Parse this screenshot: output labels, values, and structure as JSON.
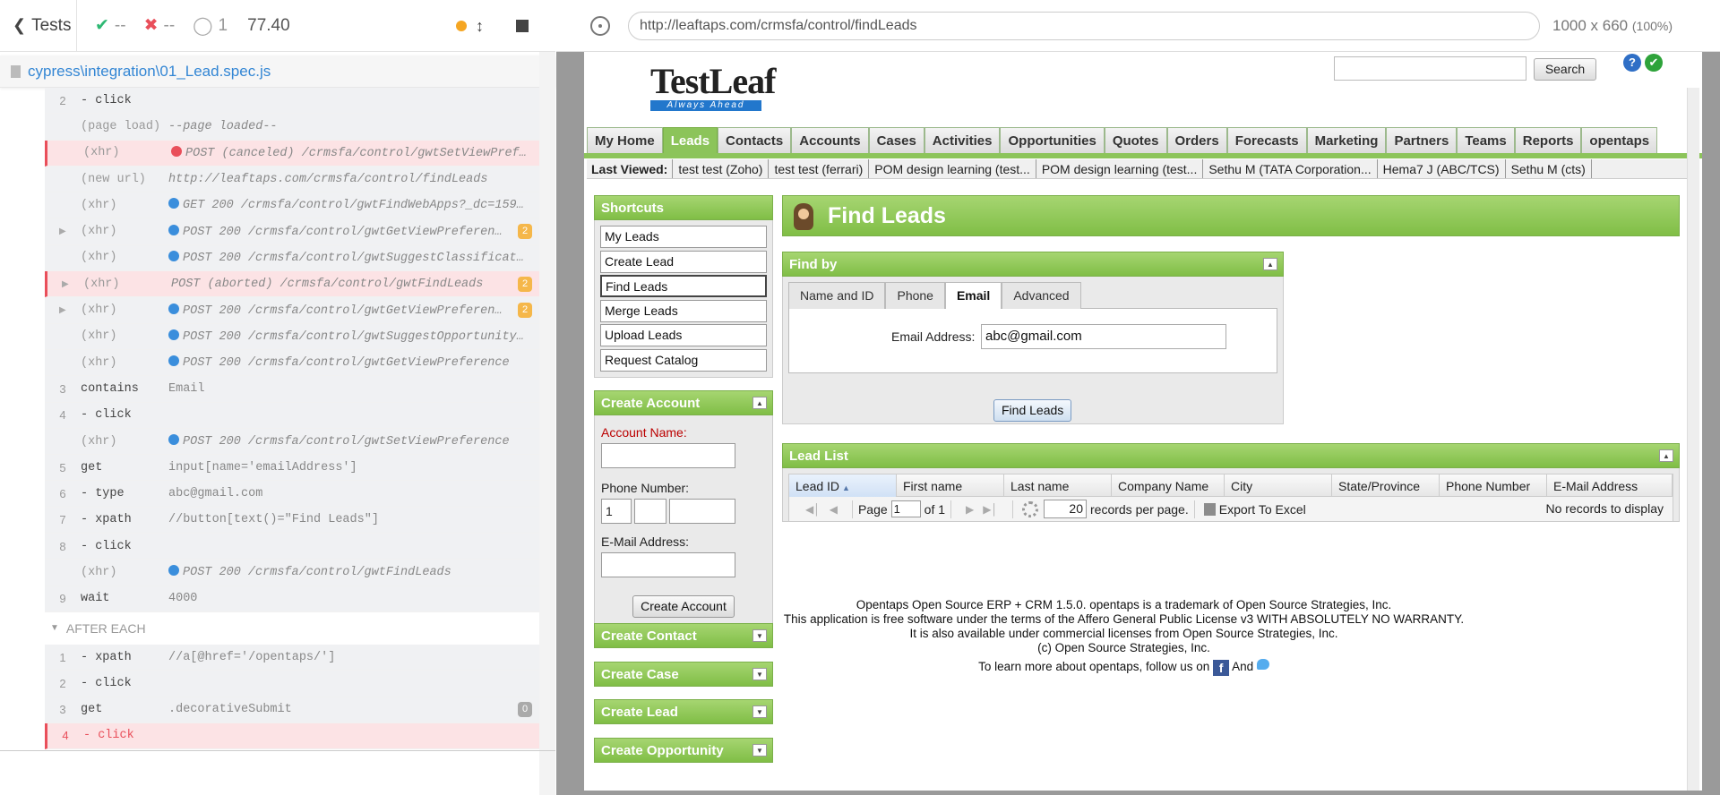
{
  "runner": {
    "tests_label": "Tests",
    "passed": "--",
    "failed": "--",
    "pending": "1",
    "duration": "77.40",
    "spec_path": "cypress\\integration\\01_Lead.spec.js",
    "commands": [
      {
        "num": "2",
        "name": "- click",
        "msg": "",
        "style": "",
        "dot": "",
        "badge": "",
        "arrow": false
      },
      {
        "num": "",
        "name": "(page load)",
        "msg": "--page loaded--",
        "style": "",
        "dot": "",
        "badge": "",
        "arrow": false
      },
      {
        "num": "",
        "name": "(xhr)",
        "msg": "POST (canceled) /crmsfa/control/gwtSetViewPref…",
        "style": "red",
        "dot": "red",
        "badge": "",
        "arrow": false
      },
      {
        "num": "",
        "name": "(new url)",
        "msg": "http://leaftaps.com/crmsfa/control/findLeads",
        "style": "",
        "dot": "",
        "badge": "",
        "arrow": false
      },
      {
        "num": "",
        "name": "(xhr)",
        "msg": "GET 200 /crmsfa/control/gwtFindWebApps?_dc=159…",
        "style": "",
        "dot": "blue",
        "badge": "",
        "arrow": false
      },
      {
        "num": "",
        "name": "(xhr)",
        "msg": "POST 200 /crmsfa/control/gwtGetViewPreferen…",
        "style": "",
        "dot": "blue",
        "badge": "2",
        "arrow": true
      },
      {
        "num": "",
        "name": "(xhr)",
        "msg": "POST 200 /crmsfa/control/gwtSuggestClassificat…",
        "style": "",
        "dot": "blue",
        "badge": "",
        "arrow": false
      },
      {
        "num": "",
        "name": "(xhr)",
        "msg": "POST (aborted) /crmsfa/control/gwtFindLeads",
        "style": "red",
        "dot": "",
        "badge": "2",
        "arrow": true
      },
      {
        "num": "",
        "name": "(xhr)",
        "msg": "POST 200 /crmsfa/control/gwtGetViewPreferen…",
        "style": "",
        "dot": "blue",
        "badge": "2",
        "arrow": true
      },
      {
        "num": "",
        "name": "(xhr)",
        "msg": "POST 200 /crmsfa/control/gwtSuggestOpportunity…",
        "style": "",
        "dot": "blue",
        "badge": "",
        "arrow": false
      },
      {
        "num": "",
        "name": "(xhr)",
        "msg": "POST 200 /crmsfa/control/gwtGetViewPreference",
        "style": "",
        "dot": "blue",
        "badge": "",
        "arrow": false
      },
      {
        "num": "3",
        "name": "contains",
        "msg": "Email",
        "style": "",
        "dot": "",
        "badge": "",
        "arrow": false
      },
      {
        "num": "4",
        "name": "- click",
        "msg": "",
        "style": "",
        "dot": "",
        "badge": "",
        "arrow": false
      },
      {
        "num": "",
        "name": "(xhr)",
        "msg": "POST 200 /crmsfa/control/gwtSetViewPreference",
        "style": "",
        "dot": "blue",
        "badge": "",
        "arrow": false
      },
      {
        "num": "5",
        "name": "get",
        "msg": "input[name='emailAddress']",
        "style": "",
        "dot": "",
        "badge": "",
        "arrow": false
      },
      {
        "num": "6",
        "name": "- type",
        "msg": "abc@gmail.com",
        "style": "",
        "dot": "",
        "badge": "",
        "arrow": false
      },
      {
        "num": "7",
        "name": "- xpath",
        "msg": "//button[text()=\"Find Leads\"]",
        "style": "",
        "dot": "",
        "badge": "",
        "arrow": false
      },
      {
        "num": "8",
        "name": "- click",
        "msg": "",
        "style": "",
        "dot": "",
        "badge": "",
        "arrow": false
      },
      {
        "num": "",
        "name": "(xhr)",
        "msg": "POST 200 /crmsfa/control/gwtFindLeads",
        "style": "",
        "dot": "blue",
        "badge": "",
        "arrow": false
      },
      {
        "num": "9",
        "name": "wait",
        "msg": "4000",
        "style": "",
        "dot": "",
        "badge": "",
        "arrow": false
      }
    ],
    "after_each_label": "AFTER EACH",
    "after_commands": [
      {
        "num": "1",
        "name": "- xpath",
        "msg": "//a[@href='/opentaps/']",
        "style": "",
        "badge": ""
      },
      {
        "num": "2",
        "name": "- click",
        "msg": "",
        "style": "",
        "badge": ""
      },
      {
        "num": "3",
        "name": "get",
        "msg": ".decorativeSubmit",
        "style": "",
        "badge": "0"
      },
      {
        "num": "4",
        "name": "- click",
        "msg": "",
        "style": "red",
        "badge": ""
      }
    ]
  },
  "aut": {
    "url": "http://leaftaps.com/crmsfa/control/findLeads",
    "viewport": "1000 x 660",
    "viewport_pct": "(100%)"
  },
  "page": {
    "logo_text": "TestLeaf",
    "logo_tagline": "Always Ahead",
    "search_button": "Search",
    "help_icon": "?",
    "tabs": [
      "My Home",
      "Leads",
      "Contacts",
      "Accounts",
      "Cases",
      "Activities",
      "Opportunities",
      "Quotes",
      "Orders",
      "Forecasts",
      "Marketing",
      "Partners",
      "Teams",
      "Reports",
      "opentaps"
    ],
    "active_tab": "Leads",
    "last_viewed_label": "Last Viewed:",
    "last_viewed": [
      "test test (Zoho)",
      "test test (ferrari)",
      "POM design learning (test...",
      "POM design learning (test...",
      "Sethu M (TATA Corporation...",
      "Hema7 J (ABC/TCS)",
      "Sethu M (cts)"
    ],
    "shortcuts": {
      "title": "Shortcuts",
      "items": [
        "My Leads",
        "Create Lead",
        "Find Leads",
        "Merge Leads",
        "Upload Leads",
        "Request Catalog"
      ],
      "selected": "Find Leads"
    },
    "create_account": {
      "title": "Create Account",
      "account_name_label": "Account Name:",
      "phone_label": "Phone Number:",
      "phone_country": "1",
      "email_label": "E-Mail Address:",
      "submit": "Create Account"
    },
    "collapsed_panels": [
      "Create Contact",
      "Create Case",
      "Create Lead",
      "Create Opportunity"
    ],
    "find_leads_title": "Find Leads",
    "find_by": {
      "title": "Find by",
      "tabs": [
        "Name and ID",
        "Phone",
        "Email",
        "Advanced"
      ],
      "active_tab": "Email",
      "email_label": "Email Address:",
      "email_value": "abc@gmail.com",
      "submit": "Find Leads"
    },
    "lead_list": {
      "title": "Lead List",
      "columns": [
        "Lead ID",
        "First name",
        "Last name",
        "Company Name",
        "City",
        "State/Province",
        "Phone Number",
        "E-Mail Address"
      ],
      "page_label": "Page",
      "page_value": "1",
      "of_label": "of 1",
      "per_page_value": "20",
      "per_page_label": "records per page.",
      "export_label": "Export To Excel",
      "empty_message": "No records to display"
    },
    "footer": {
      "line1": "Opentaps Open Source ERP + CRM 1.5.0. opentaps is a trademark of Open Source Strategies, Inc.",
      "line2": "This application is free software under the terms of the Affero General Public License v3 WITH ABSOLUTELY NO WARRANTY.",
      "line3": "It is also available under commercial licenses from Open Source Strategies, Inc.",
      "line4": "(c) Open Source Strategies, Inc.",
      "follow_text": "To learn more about opentaps, follow us on",
      "and_text": "And",
      "facebook_glyph": "f"
    }
  }
}
